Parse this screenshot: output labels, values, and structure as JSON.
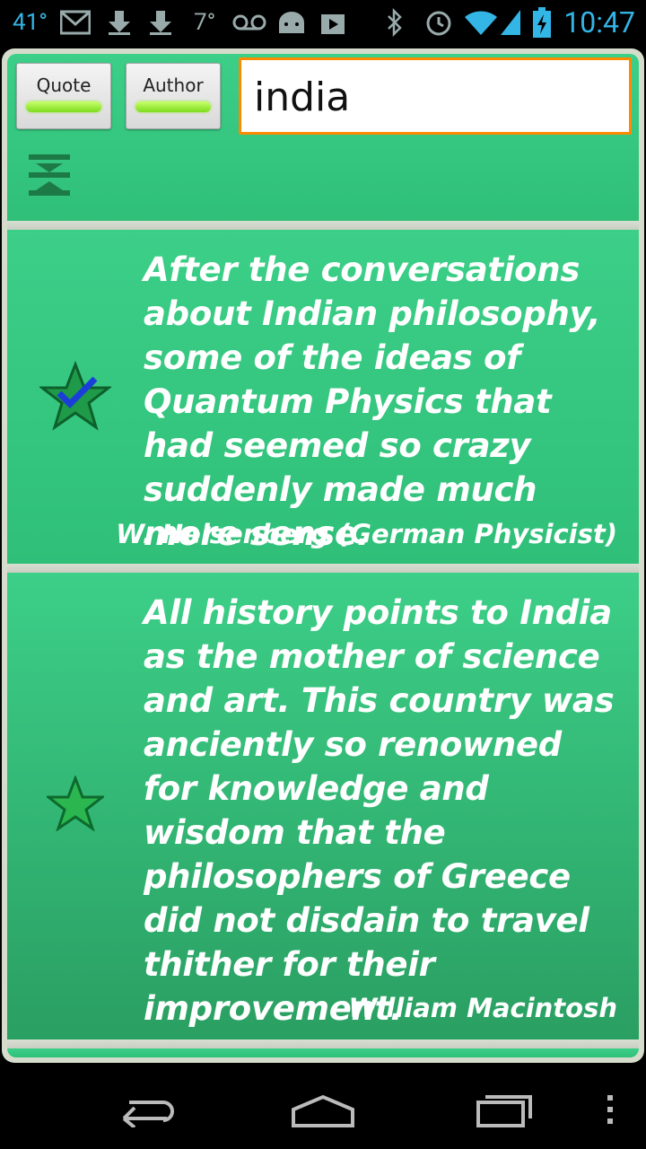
{
  "status_bar": {
    "temperature": "41°",
    "temp_small": "7°",
    "clock": "10:47",
    "icons": [
      "gmail-icon",
      "download-icon",
      "download-icon",
      "voicemail-icon",
      "android-debug-icon",
      "store-icon",
      "bluetooth-icon",
      "alarm-icon",
      "wifi-icon",
      "signal-icon",
      "battery-charging-icon"
    ]
  },
  "toolbar": {
    "quote_label": "Quote",
    "author_label": "Author",
    "search_value": "india",
    "search_placeholder": "",
    "collapse_icon": "collapse-icon"
  },
  "quotes": [
    {
      "text": "After the conversations about Indian philosophy, some of the ideas of Quantum Physics that had seemed so crazy suddenly made much more sense.",
      "author": "W.  Heisenberg (German Physicist)",
      "favorite": true,
      "star_icon": "favorite-checked-star-icon"
    },
    {
      "text": "All history points to India as the mother of science and art.  This country was anciently so renowned for knowledge and wisdom that the philosophers of Greece did not disdain to travel thither for their improvement.",
      "author": "William Macintosh",
      "favorite": false,
      "star_icon": "star-icon"
    }
  ],
  "nav_bar": {
    "icons": [
      "back-icon",
      "home-icon",
      "recent-apps-icon",
      "menu-icon"
    ]
  },
  "colors": {
    "card_green": "#35c680",
    "search_border": "#ff8a00",
    "status_blue": "#33b5e5",
    "indicator_green": "#8be11f"
  }
}
